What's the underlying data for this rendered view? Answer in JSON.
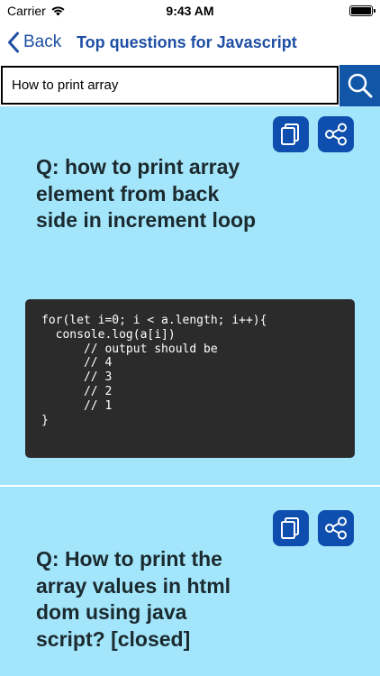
{
  "status": {
    "carrier": "Carrier",
    "time": "9:43 AM",
    "battery_level": 1.0
  },
  "nav": {
    "back_label": "Back",
    "title": "Top questions for Javascript"
  },
  "search": {
    "value": "How to print array",
    "placeholder": ""
  },
  "questions": [
    {
      "title": "Q: how to print array element from back side in increment loop",
      "code": "for(let i=0; i < a.length; i++){\n  console.log(a[i])\n      // output should be\n      // 4\n      // 3\n      // 2\n      // 1\n}"
    },
    {
      "title": "Q: How to print the array values in html dom using java script? [closed]"
    }
  ],
  "colors": {
    "accent": "#1f4fa3",
    "icon_button": "#0d4eae",
    "search_button": "#1256a8",
    "background": "#a3e5fb",
    "code_background": "#2b2b2b"
  },
  "icons": {
    "copy": "copy-icon",
    "share": "share-icon",
    "search": "search-icon",
    "back": "chevron-left-icon"
  }
}
